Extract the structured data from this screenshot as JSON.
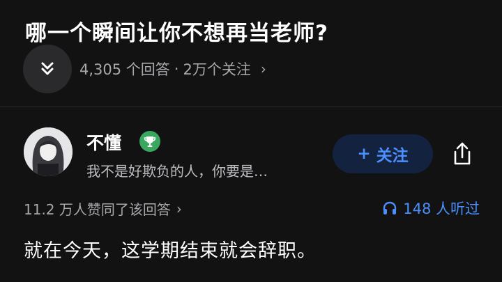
{
  "question": {
    "title": "哪一个瞬间让你不想再当老师?",
    "answers_count": "4,305 个回答",
    "separator": "·",
    "followers": "2万个关注",
    "chevron": "›"
  },
  "answer": {
    "author": {
      "name": "不懂",
      "bio": "我不是好欺负的人，你要是…",
      "badge_icon": "trophy-icon"
    },
    "follow_button": {
      "plus": "+",
      "label": "关注"
    },
    "agree_text": "11.2 万人赞同了该回答",
    "agree_chevron": "›",
    "listen_text": "148 人听过",
    "body_text": "就在今天，这学期结束就会辞职。"
  },
  "colors": {
    "background": "#121212",
    "accent_blue": "#4b8fff",
    "follow_bg": "#13233f",
    "badge_green": "#3aa760",
    "muted_text": "#a9a9ad"
  }
}
